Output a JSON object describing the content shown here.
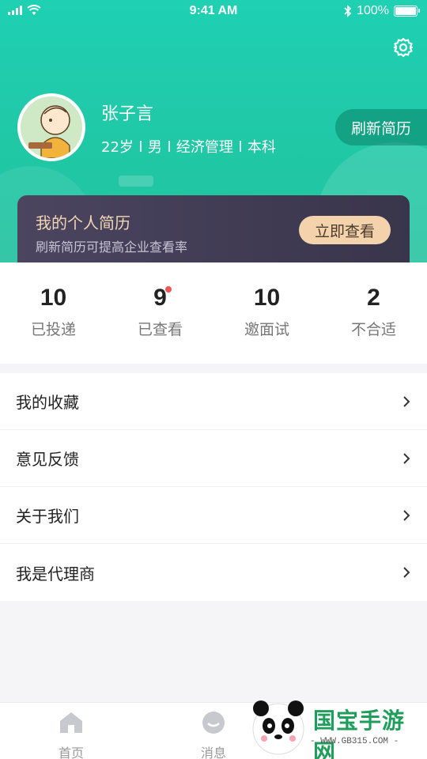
{
  "status_bar": {
    "time": "9:41 AM",
    "battery": "100%"
  },
  "profile": {
    "name": "张子言",
    "age": "22岁",
    "gender": "男",
    "major": "经济管理",
    "degree": "本科",
    "refresh_button": "刷新简历"
  },
  "resume_card": {
    "title": "我的个人简历",
    "subtitle": "刷新简历可提高企业查看率",
    "button": "立即查看"
  },
  "stats": [
    {
      "value": "10",
      "label": "已投递"
    },
    {
      "value": "9",
      "label": "已查看",
      "has_dot": true
    },
    {
      "value": "10",
      "label": "邀面试"
    },
    {
      "value": "2",
      "label": "不合适"
    }
  ],
  "menu": [
    {
      "label": "我的收藏"
    },
    {
      "label": "意见反馈"
    },
    {
      "label": "关于我们"
    },
    {
      "label": "我是代理商"
    }
  ],
  "tabbar": [
    {
      "label": "首页",
      "icon": "home-icon"
    },
    {
      "label": "消息",
      "icon": "message-icon"
    }
  ],
  "watermark": {
    "text": "国宝手游网",
    "url": "- WWW.GB315.COM -"
  },
  "colors": {
    "header": "#20c8a6",
    "card": "#3f3a52",
    "accent": "#f3d2ac",
    "dot": "#f05454"
  }
}
